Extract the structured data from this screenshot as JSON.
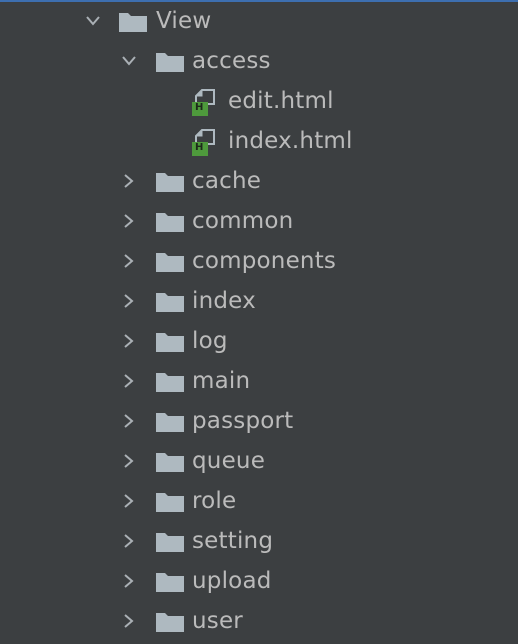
{
  "tree": {
    "root": {
      "label": "View",
      "expanded": true
    },
    "access": {
      "label": "access",
      "expanded": true
    },
    "files": [
      {
        "label": "edit.html",
        "icon": "html-file-icon"
      },
      {
        "label": "index.html",
        "icon": "html-file-icon"
      }
    ],
    "file_badge_letter": "H",
    "folders": [
      {
        "label": "cache"
      },
      {
        "label": "common"
      },
      {
        "label": "components"
      },
      {
        "label": "index"
      },
      {
        "label": "log"
      },
      {
        "label": "main"
      },
      {
        "label": "passport"
      },
      {
        "label": "queue"
      },
      {
        "label": "role"
      },
      {
        "label": "setting"
      },
      {
        "label": "upload"
      },
      {
        "label": "user"
      }
    ]
  },
  "colors": {
    "background": "#3c3f41",
    "text": "#bbbbbb",
    "folder": "#aeb9c0",
    "html_badge": "#4e9a3c",
    "accent_line": "#3d6fb0"
  }
}
